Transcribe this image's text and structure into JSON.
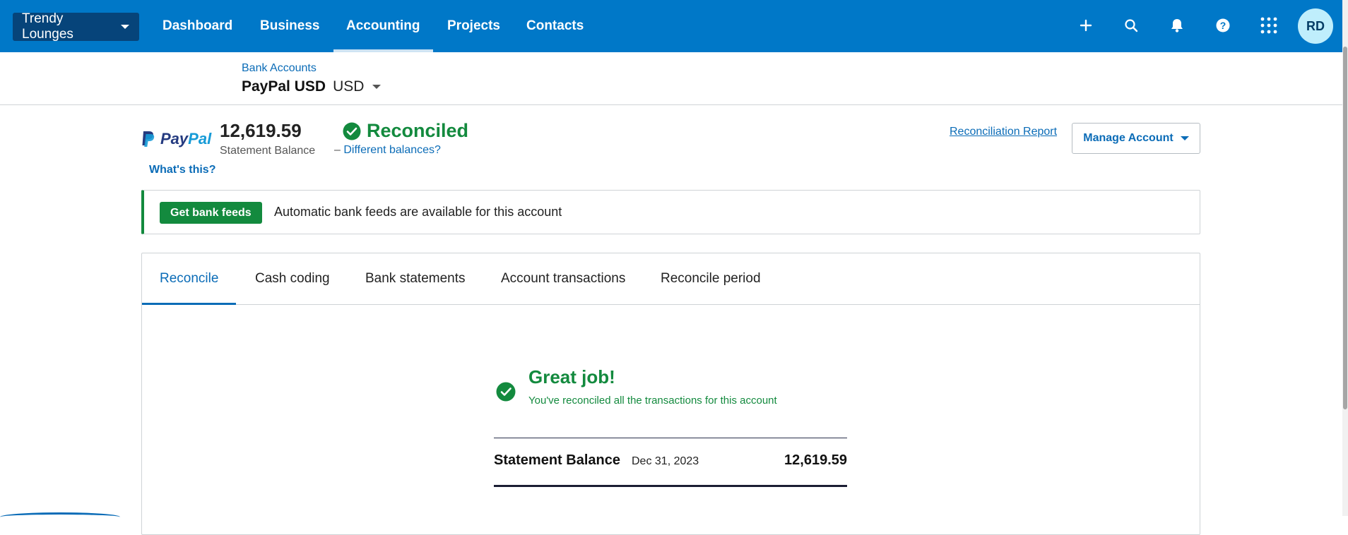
{
  "topnav": {
    "org_name": "Trendy Lounges",
    "tabs": [
      {
        "label": "Dashboard"
      },
      {
        "label": "Business"
      },
      {
        "label": "Accounting"
      },
      {
        "label": "Projects"
      },
      {
        "label": "Contacts"
      }
    ],
    "active_tab": "Accounting",
    "icons": [
      "plus-icon",
      "search-icon",
      "bell-icon",
      "help-icon",
      "apps-grid-icon"
    ],
    "avatar_initials": "RD",
    "colors": {
      "bar": "#0078c8",
      "org_button": "#06447a",
      "avatar": "#bfeefc"
    }
  },
  "subheader": {
    "breadcrumb": "Bank Accounts",
    "account_name": "PayPal USD",
    "currency": "USD"
  },
  "summary": {
    "logo_text_a": "Pay",
    "logo_text_b": "Pal",
    "statement_balance": "12,619.59",
    "statement_balance_label": "Statement Balance",
    "status": "Reconciled",
    "different_balances_prefix": "–",
    "different_balances_link": "Different balances?",
    "whats_this": "What's this?",
    "reconciliation_report": "Reconciliation Report",
    "manage_account": "Manage Account"
  },
  "banner": {
    "button_label": "Get bank feeds",
    "text": "Automatic bank feeds are available for this account"
  },
  "tabs": {
    "items": [
      {
        "label": "Reconcile"
      },
      {
        "label": "Cash coding"
      },
      {
        "label": "Bank statements"
      },
      {
        "label": "Account transactions"
      },
      {
        "label": "Reconcile period"
      }
    ],
    "active": "Reconcile"
  },
  "reconcile": {
    "title": "Great job!",
    "subtitle": "You've reconciled all the transactions for this account",
    "statement_label": "Statement Balance",
    "statement_date": "Dec 31, 2023",
    "statement_value": "12,619.59"
  },
  "colors": {
    "success": "#138a3e",
    "link": "#0b6cb7"
  }
}
